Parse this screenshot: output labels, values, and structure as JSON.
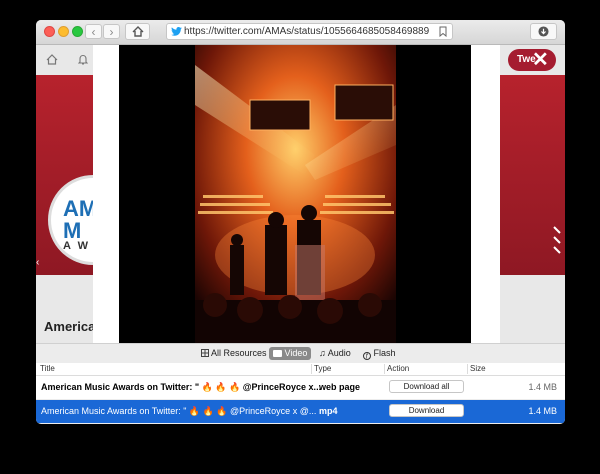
{
  "browser": {
    "url": "https://twitter.com/AMAs/status/1055664685058469889"
  },
  "page": {
    "ama_logo_top": "AME\nM",
    "ama_logo_sub": "A W",
    "profile_name": "American",
    "tweet_button": "Twe"
  },
  "scopes": [
    {
      "label": "All Resources",
      "icon": "grid-icon",
      "selected": false
    },
    {
      "label": "Video",
      "icon": "video-icon",
      "selected": true
    },
    {
      "label": "Audio",
      "icon": "music-note-icon",
      "selected": false
    },
    {
      "label": "Flash",
      "icon": "flash-icon",
      "selected": false
    }
  ],
  "table": {
    "headers": [
      "Title",
      "Type",
      "Action",
      "Size"
    ],
    "rows": [
      {
        "title": "American Music Awards on Twitter: \" 🔥 🔥 🔥 @PrinceRoyce x...",
        "type": "web page",
        "action": "Download all",
        "size": "1.4 MB"
      },
      {
        "title": "American Music Awards on Twitter: \" 🔥 🔥 🔥 @PrinceRoyce x @...",
        "type": "mp4",
        "action": "Download",
        "size": "1.4 MB"
      }
    ]
  },
  "colors": {
    "selection": "#1a68d6",
    "brand_red": "#a51c30"
  }
}
